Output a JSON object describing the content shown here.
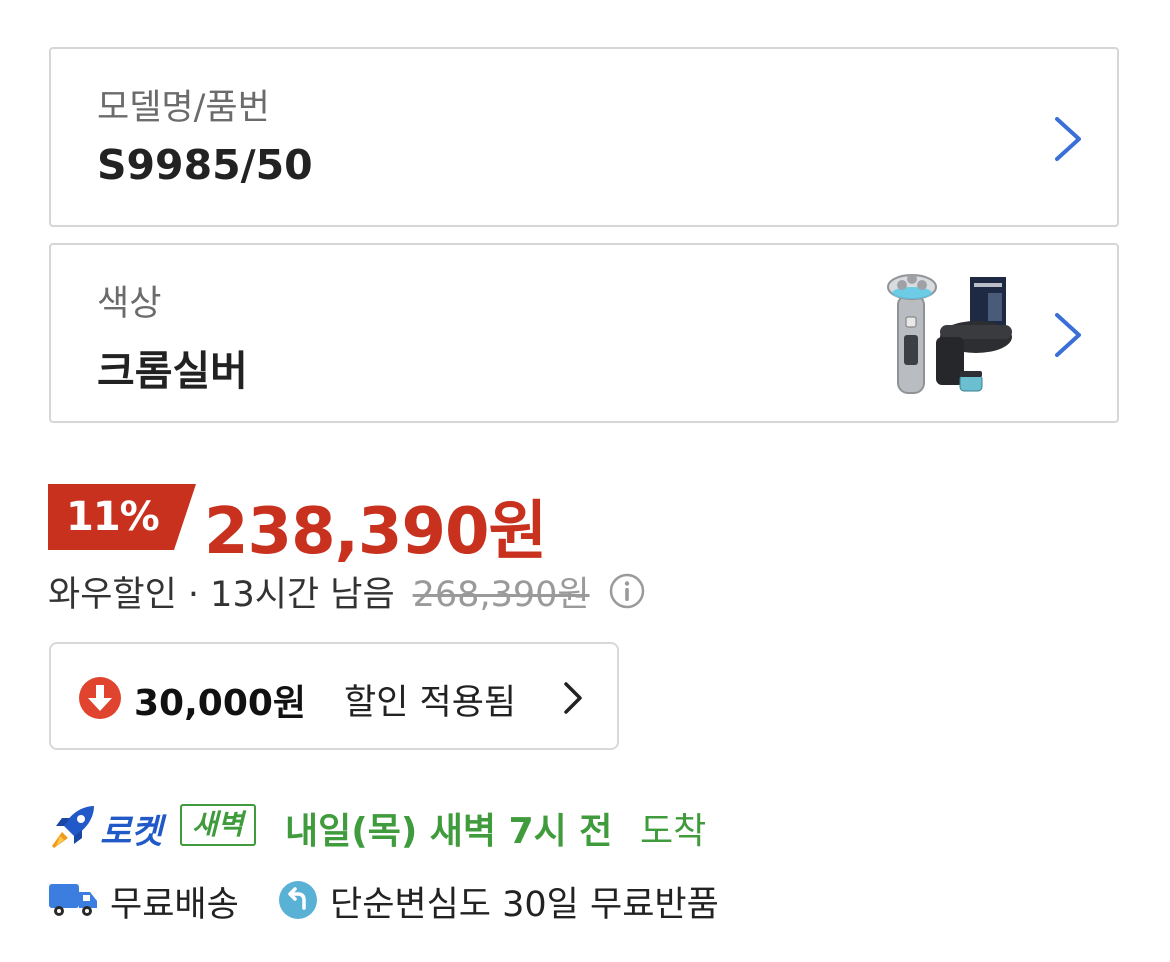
{
  "options": {
    "model": {
      "label": "모델명/품번",
      "value": "S9985/50"
    },
    "color": {
      "label": "색상",
      "value": "크롬실버"
    }
  },
  "price": {
    "discount_rate": "11%",
    "sale_price": "238,390원",
    "wow_text": "와우할인 · 13시간 남음",
    "original_price": "268,390원"
  },
  "coupon": {
    "amount": "30,000원",
    "label": "할인 적용됨"
  },
  "delivery": {
    "rocket_label": "로켓",
    "dawn_label": "새벽",
    "arrival_strong": "내일(목) 새벽 7시 전",
    "arrival_rest": "도착"
  },
  "shipping": {
    "free_shipping": "무료배송",
    "free_return": "단순변심도 30일 무료반품"
  },
  "colors": {
    "price_red": "#c9311f",
    "badge_red": "#c9311f",
    "rocket_blue": "#2259c9",
    "dawn_green": "#3f9b3c",
    "chevron_blue": "#3b6fd8"
  },
  "icons": {
    "option_chevron": "chevron-right-icon",
    "info": "info-icon",
    "coupon": "down-arrow-circle-icon",
    "rocket": "rocket-icon",
    "truck": "truck-icon",
    "return": "return-arrow-icon"
  }
}
